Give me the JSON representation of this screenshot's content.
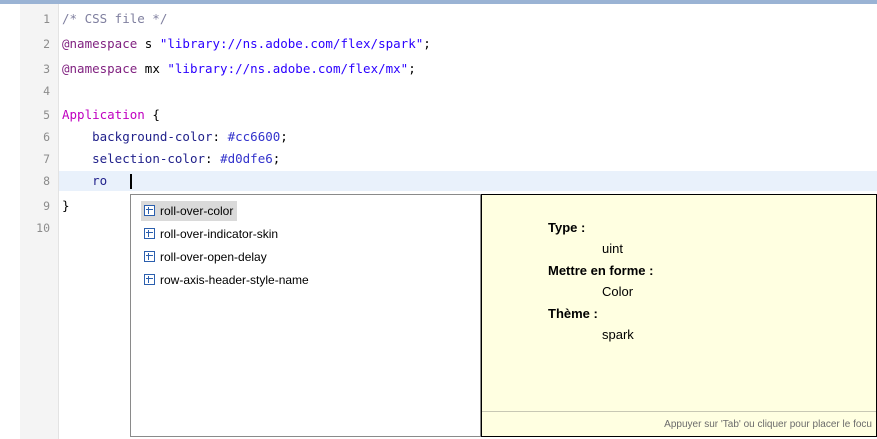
{
  "editor": {
    "line_numbers": [
      "1",
      "2",
      "3",
      "4",
      "5",
      "6",
      "7",
      "8",
      "9",
      "10"
    ],
    "lines": {
      "l1": {
        "comment": "/* CSS file */"
      },
      "l2": {
        "keyword": "@namespace",
        "prefix": " s ",
        "string": "\"library://ns.adobe.com/flex/spark\"",
        "end": ";"
      },
      "l3": {
        "keyword": "@namespace",
        "prefix": " mx ",
        "string": "\"library://ns.adobe.com/flex/mx\"",
        "end": ";"
      },
      "l5": {
        "selector": "Application",
        "open": " {"
      },
      "l6": {
        "indent": "    ",
        "property": "background-color",
        "colon": ": ",
        "value": "#cc6600",
        "end": ";"
      },
      "l7": {
        "indent": "    ",
        "property": "selection-color",
        "colon": ": ",
        "value": "#d0dfe6",
        "end": ";"
      },
      "l8": {
        "indent": "    ",
        "typed": "ro"
      },
      "l9": {
        "close": "}"
      }
    }
  },
  "autocomplete": {
    "items": [
      {
        "label": "roll-over-color",
        "icon": "style-property-icon",
        "selected": true
      },
      {
        "label": "roll-over-indicator-skin",
        "icon": "style-property-icon",
        "selected": false
      },
      {
        "label": "roll-over-open-delay",
        "icon": "style-property-icon",
        "selected": false
      },
      {
        "label": "row-axis-header-style-name",
        "icon": "style-property-icon",
        "selected": false
      }
    ]
  },
  "doc": {
    "type_label": "Type :",
    "type_value": "uint",
    "format_label": "Mettre en forme :",
    "format_value": "Color",
    "theme_label": "Thème :",
    "theme_value": "spark",
    "footer": "Appuyer sur 'Tab' ou cliquer pour placer le focu"
  }
}
